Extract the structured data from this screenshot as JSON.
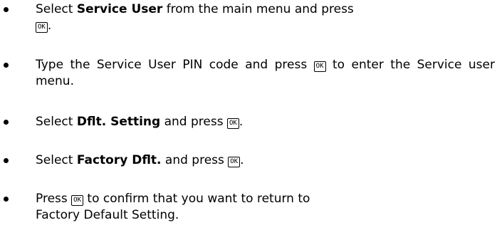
{
  "steps": [
    {
      "part1": "Select ",
      "bold1": "Service User",
      "part2": " from the main menu and press",
      "key": "OK",
      "part3": "."
    },
    {
      "part1": "Type the Service User PIN code and press ",
      "key": "OK",
      "part2": " to enter the Service user menu."
    },
    {
      "part1": "Select ",
      "bold1": "Dflt. Setting",
      "part2": " and press ",
      "key": "OK",
      "part3": "."
    },
    {
      "part1": "Select ",
      "bold1": "Factory Dflt.",
      "part2": " and press ",
      "key": "OK",
      "part3": "."
    },
    {
      "part1": "Press ",
      "key": "OK",
      "part2": " to confirm that you want to return to",
      "part3": "Factory Default Setting."
    }
  ]
}
